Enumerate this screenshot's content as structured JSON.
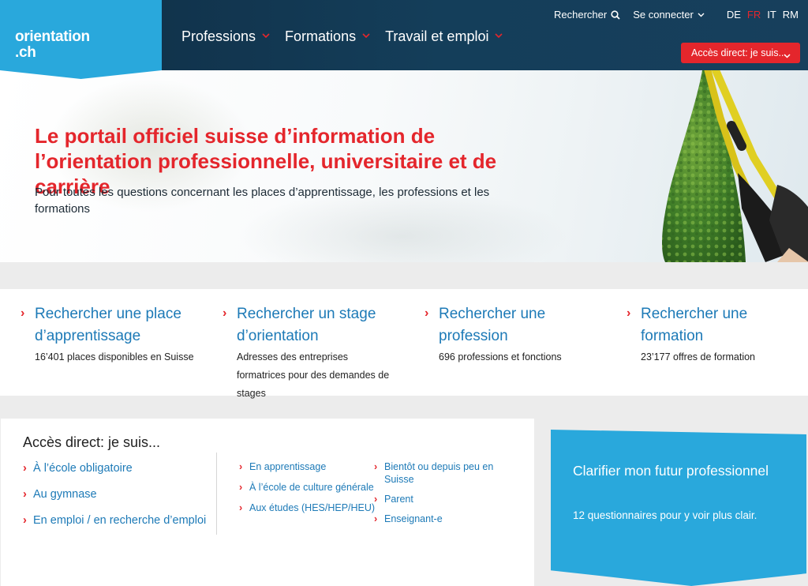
{
  "header": {
    "logo_line1": "orientation",
    "logo_line2": ".ch",
    "nav": [
      {
        "label": "Professions"
      },
      {
        "label": "Formations"
      },
      {
        "label": "Travail et emploi"
      }
    ],
    "search_label": "Rechercher",
    "login_label": "Se connecter",
    "languages": [
      "DE",
      "FR",
      "IT",
      "RM"
    ],
    "active_language": "FR",
    "direct_access_label": "Accès direct: je suis..."
  },
  "hero": {
    "title": "Le portail officiel suisse d’information de l’orientation professionnelle, universitaire et de carrière",
    "subtitle": "Pour toutes les questions concernant les places d’apprentissage, les professions et les formations"
  },
  "quick_links": [
    {
      "title": "Rechercher une place d’apprentissage",
      "desc": "16’401 places disponibles en Suisse"
    },
    {
      "title": "Rechercher un stage d’orientation",
      "desc": "Adresses des entreprises formatrices pour des demandes de stages"
    },
    {
      "title": "Rechercher une profession",
      "desc": "696 professions et fonctions"
    },
    {
      "title": "Rechercher une formation",
      "desc": "23’177 offres de formation"
    }
  ],
  "direct_access": {
    "title": "Accès direct: je suis...",
    "col1": [
      "À l’école obligatoire",
      "Au gymnase",
      "En emploi / en recherche d’emploi"
    ],
    "col2": [
      "En apprentissage",
      "À l’école de culture générale",
      "Aux études (HES/HEP/HEU)"
    ],
    "col3": [
      "Bientôt ou depuis peu en Suisse",
      "Parent",
      "Enseignant-e"
    ]
  },
  "cta": {
    "title": "Clarifier mon futur professionnel",
    "text": "12 questionnaires pour y voir plus clair."
  },
  "colors": {
    "brand_blue": "#29a8dc",
    "accent_red": "#e4262c",
    "header_dark": "#0f2d44",
    "link_blue": "#1d7ab7"
  },
  "icons": {
    "search": "search-icon",
    "chevron": "chevron-down-icon",
    "arrow": "arrow-right-icon"
  }
}
